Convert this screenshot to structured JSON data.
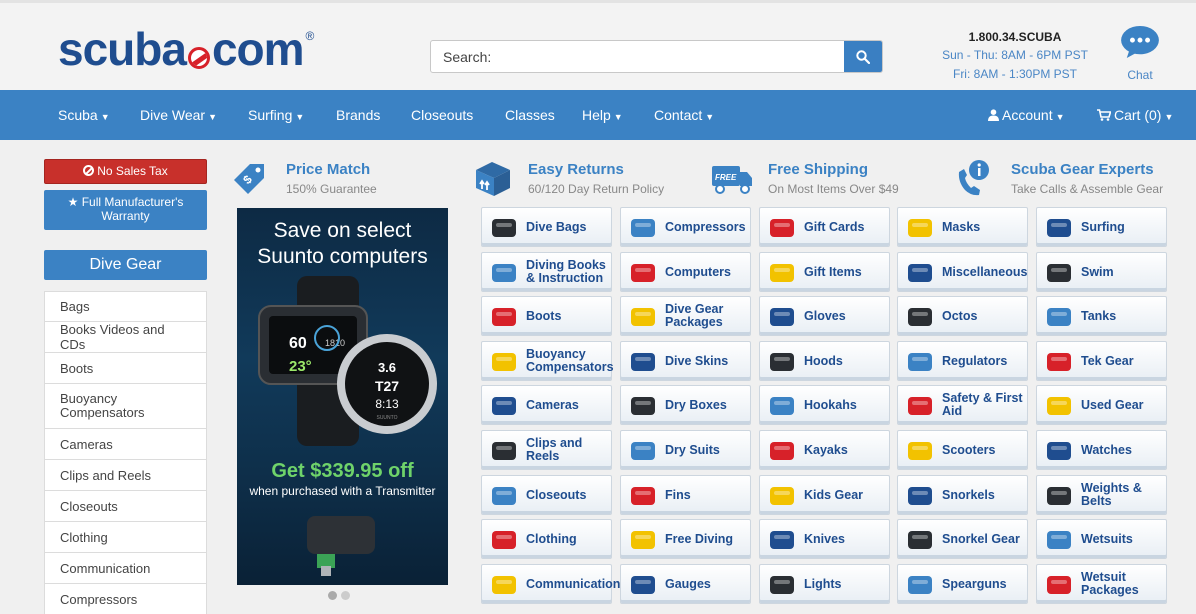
{
  "header": {
    "logo": {
      "word1": "scuba",
      "word2": "com",
      "reg": "®"
    },
    "search": {
      "placeholder": "Search:"
    },
    "phone": "1.800.34.SCUBA",
    "hours_weekday": "Sun - Thu: 8AM - 6PM PST",
    "hours_friday": "Fri: 8AM - 1:30PM PST",
    "chat_label": "Chat"
  },
  "nav": {
    "items": [
      {
        "label": "Scuba",
        "caret": "⌵"
      },
      {
        "label": "Dive Wear",
        "caret": "⌵"
      },
      {
        "label": "Surfing",
        "caret": "⌵"
      },
      {
        "label": "Brands",
        "caret": ""
      },
      {
        "label": "Closeouts",
        "caret": ""
      },
      {
        "label": "Classes",
        "caret": ""
      },
      {
        "label": "Help",
        "caret": "⌵"
      },
      {
        "label": "Contact",
        "caret": "⌵"
      }
    ],
    "account": "Account",
    "cart": "Cart (0)"
  },
  "sidebar": {
    "no_sales_tax": "No Sales Tax",
    "warranty": "Full Manufacturer's Warranty",
    "heading": "Dive Gear",
    "items": [
      "Bags",
      "Books Videos and CDs",
      "Boots",
      "Buoyancy Compensators",
      "Cameras",
      "Clips and Reels",
      "Closeouts",
      "Clothing",
      "Communication",
      "Compressors"
    ]
  },
  "features": [
    {
      "title": "Price Match",
      "subtitle": "150% Guarantee",
      "icon": "tag-icon"
    },
    {
      "title": "Easy Returns",
      "subtitle": "60/120 Day Return Policy",
      "icon": "box-return-icon"
    },
    {
      "title": "Free Shipping",
      "subtitle": "On Most Items Over $49",
      "icon": "truck-icon",
      "icon_text": "FREE"
    },
    {
      "title": "Scuba Gear Experts",
      "subtitle": "Take Calls & Assemble Gear",
      "icon": "phone-info-icon"
    }
  ],
  "promo": {
    "line1": "Save on select",
    "line2": "Suunto computers",
    "offer": "Get $339.95 off",
    "sub": "when purchased with a Transmitter",
    "watch_left": {
      "depth": "60",
      "temp": "23°",
      "small": "1810"
    },
    "watch_right": {
      "l1": "3.6",
      "l2": "T27",
      "l3": "8:13",
      "brand": "SUUNTO"
    }
  },
  "categories": [
    [
      "Dive Bags",
      "Compressors",
      "Gift Cards",
      "Masks",
      "Surfing"
    ],
    [
      "Diving Books & Instruction",
      "Computers",
      "Gift Items",
      "Miscellaneous",
      "Swim"
    ],
    [
      "Boots",
      "Dive Gear Packages",
      "Gloves",
      "Octos",
      "Tanks"
    ],
    [
      "Buoyancy Compensators",
      "Dive Skins",
      "Hoods",
      "Regulators",
      "Tek Gear"
    ],
    [
      "Cameras",
      "Dry Boxes",
      "Hookahs",
      "Safety & First Aid",
      "Used Gear"
    ],
    [
      "Clips and Reels",
      "Dry Suits",
      "Kayaks",
      "Scooters",
      "Watches"
    ],
    [
      "Closeouts",
      "Fins",
      "Kids Gear",
      "Snorkels",
      "Weights & Belts"
    ],
    [
      "Clothing",
      "Free Diving",
      "Knives",
      "Snorkel Gear",
      "Wetsuits"
    ],
    [
      "Communication",
      "Gauges",
      "Lights",
      "Spearguns",
      "Wetsuit Packages"
    ]
  ],
  "colors": {
    "brand_blue": "#3b82c4",
    "logo_blue": "#1f4d8f",
    "alert_red": "#c8302b",
    "offer_green": "#6fd36a"
  }
}
